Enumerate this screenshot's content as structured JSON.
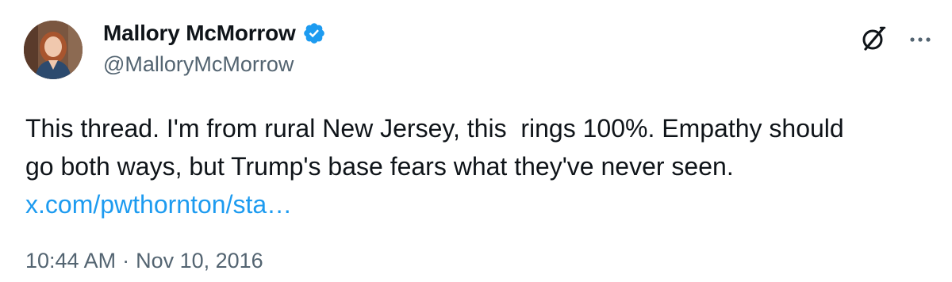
{
  "author": {
    "display_name": "Mallory McMorrow",
    "handle": "@MalloryMcMorrow",
    "verified": true,
    "verified_color": "#1d9bf0"
  },
  "actions": {
    "grok_icon": "grok-icon",
    "more_icon": "more-options-icon"
  },
  "tweet": {
    "text_line1": "This thread. I'm from rural New Jersey, this  rings 100%. Empathy should",
    "text_line2": "go both ways, but Trump's base fears what they've never seen.",
    "link": "x.com/pwthornton/sta…",
    "link_color": "#1d9bf0"
  },
  "meta": {
    "time": "10:44 AM",
    "separator": "·",
    "date": "Nov 10, 2016"
  },
  "colors": {
    "text": "#0f1419",
    "secondary": "#536471",
    "background": "#ffffff"
  }
}
